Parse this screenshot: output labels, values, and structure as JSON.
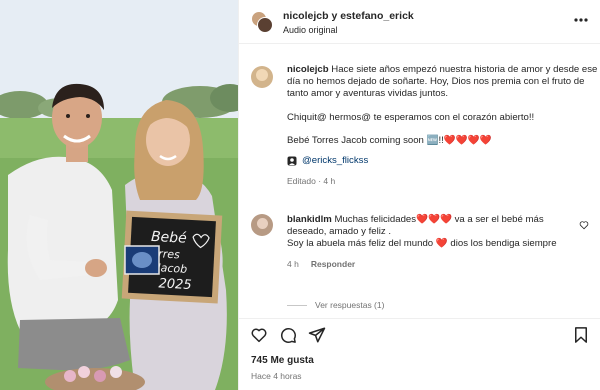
{
  "header": {
    "username_1": "nicolejcb",
    "joiner": "y",
    "username_2": "estefano_erick",
    "audio": "Audio original"
  },
  "photo": {
    "board_line1": "Bebé",
    "board_line2": "Torres",
    "board_line3": "Jacob",
    "board_line4": "2025"
  },
  "caption": {
    "username": "nicolejcb",
    "paragraph_1": "Hace siete años empezó nuestra historia de amor y desde ese día no hemos dejado de soñarte. Hoy, Dios nos premia con el fruto de tanto amor y aventuras vividas juntos.",
    "paragraph_2": "Chiquit@ hermos@ te esperamos con el corazón abierto!!",
    "paragraph_3": "Bebé Torres Jacob coming soon 🆕!!❤️❤️❤️❤️",
    "tag": "@ericks_flickss",
    "meta": "Editado · 4 h"
  },
  "comment": {
    "username": "blankidlm",
    "text_1": "Muchas felicidades",
    "hearts": "❤️❤️❤️",
    "text_2": "va a ser el bebé más deseado, amado y feliz .",
    "text_3": "Soy la abuela más feliz del mundo",
    "heart_2": "❤️",
    "text_4": "dios los bendiga siempre",
    "time": "4 h",
    "reply_label": "Responder"
  },
  "replies": {
    "label": "Ver respuestas (1)"
  },
  "footer": {
    "likes": "745 Me gusta",
    "time": "Hace 4 horas"
  },
  "icons": {
    "like": "heart-icon",
    "comment": "comment-icon",
    "share": "share-icon",
    "save": "bookmark-icon",
    "more": "more-icon",
    "tag": "person-tag-icon"
  },
  "colors": {
    "text": "#262626",
    "muted": "#737373",
    "heart": "#e0245e",
    "link": "#00376b"
  }
}
